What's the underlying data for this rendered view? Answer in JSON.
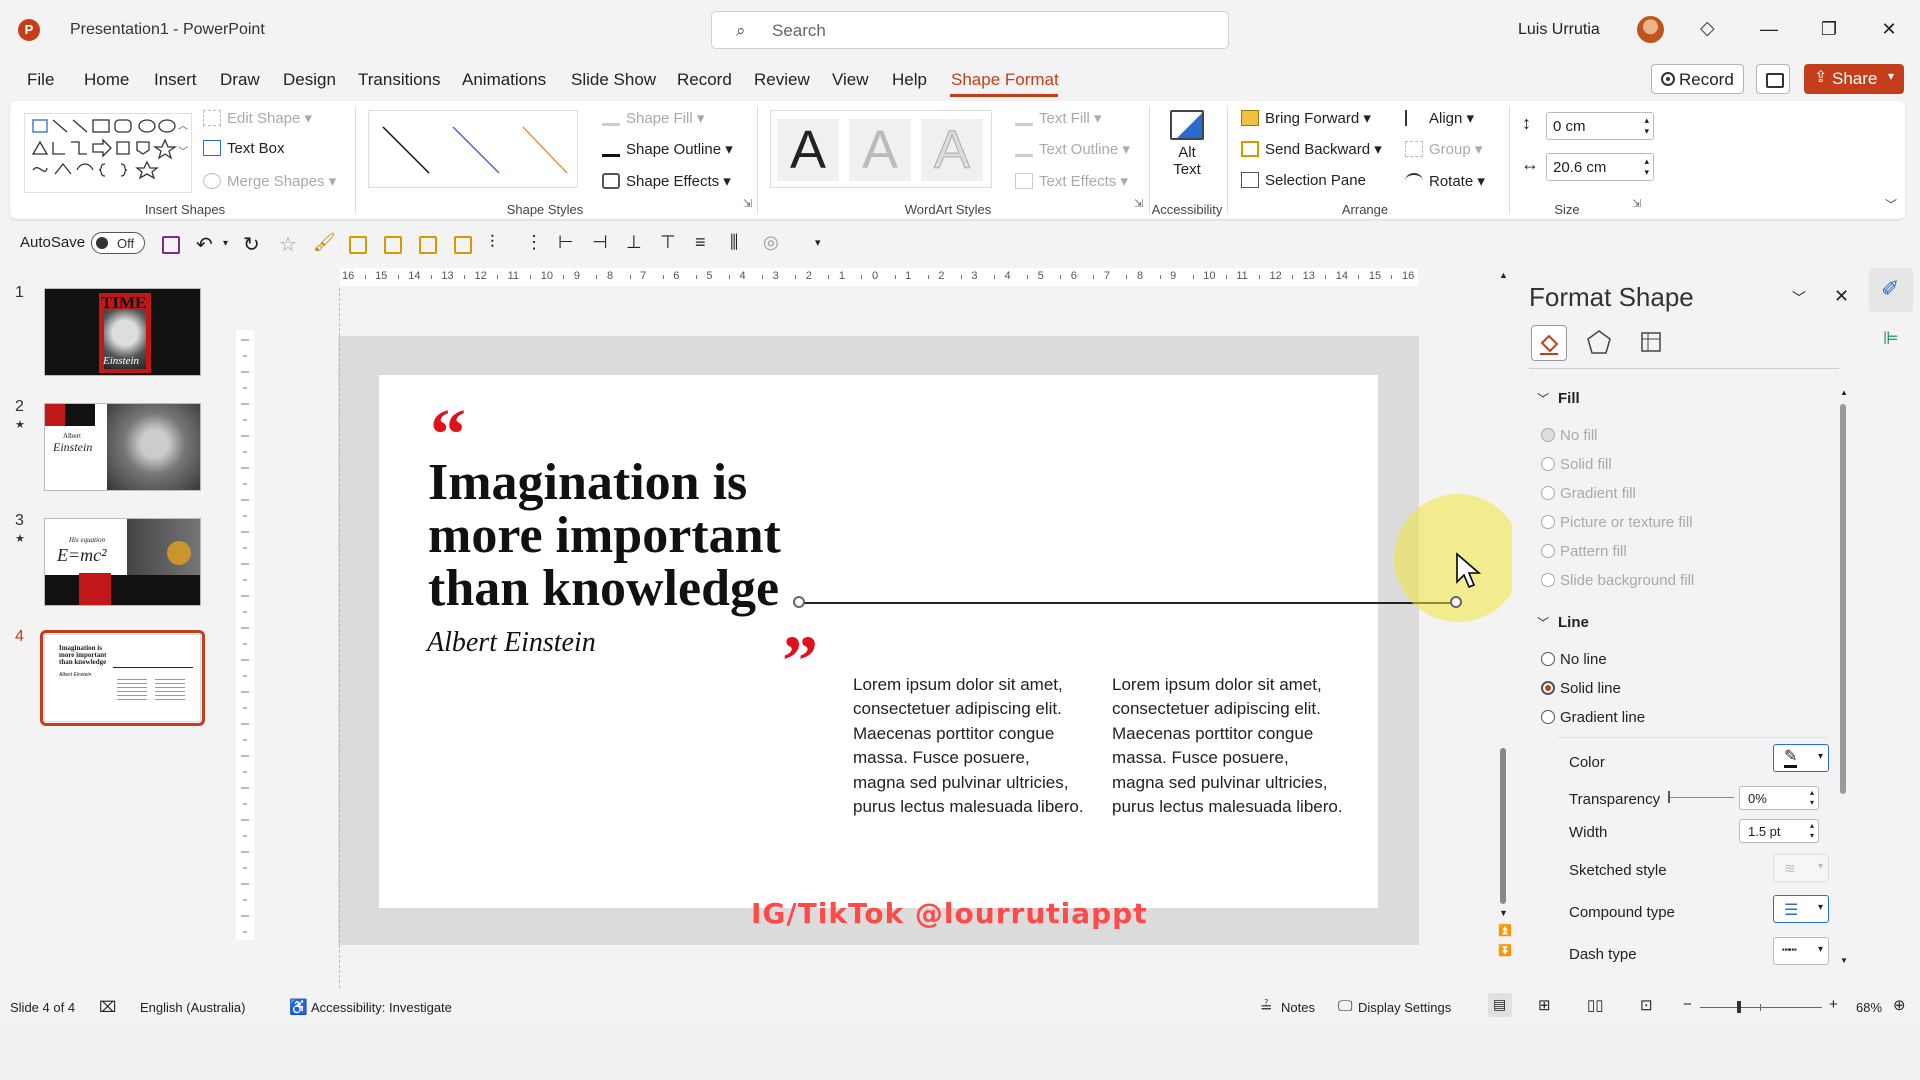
{
  "titlebar": {
    "app_logo": "P",
    "doc_title": "Presentation1  -  PowerPoint",
    "search_placeholder": "Search",
    "user_name": "Luis Urrutia"
  },
  "tabs": [
    "File",
    "Home",
    "Insert",
    "Draw",
    "Design",
    "Transitions",
    "Animations",
    "Slide Show",
    "Record",
    "Review",
    "View",
    "Help",
    "Shape Format"
  ],
  "actions": {
    "record": "Record",
    "share": "Share"
  },
  "ribbon": {
    "insert_shapes": {
      "group": "Insert Shapes",
      "edit_shape": "Edit Shape",
      "text_box": "Text Box",
      "merge_shapes": "Merge Shapes"
    },
    "shape_styles": {
      "group": "Shape Styles",
      "shape_fill": "Shape Fill",
      "shape_outline": "Shape Outline",
      "shape_effects": "Shape Effects"
    },
    "wordart": {
      "group": "WordArt Styles",
      "letter": "A",
      "text_fill": "Text Fill",
      "text_outline": "Text Outline",
      "text_effects": "Text Effects"
    },
    "accessibility": {
      "group": "Accessibility",
      "alt_text_1": "Alt",
      "alt_text_2": "Text"
    },
    "arrange": {
      "group": "Arrange",
      "bring_forward": "Bring Forward",
      "send_backward": "Send Backward",
      "selection_pane": "Selection Pane",
      "align": "Align",
      "group_btn": "Group",
      "rotate": "Rotate"
    },
    "size": {
      "group": "Size",
      "height": "0 cm",
      "width": "20.6 cm"
    }
  },
  "qat": {
    "autosave": "AutoSave",
    "toggle": "Off"
  },
  "ruler_ticks": [
    "16",
    "15",
    "14",
    "13",
    "12",
    "11",
    "10",
    "9",
    "8",
    "7",
    "6",
    "5",
    "4",
    "3",
    "2",
    "1",
    "0",
    "1",
    "2",
    "3",
    "4",
    "5",
    "6",
    "7",
    "8",
    "9",
    "10",
    "11",
    "12",
    "13",
    "14",
    "15",
    "16"
  ],
  "thumbnails": [
    {
      "num": "1",
      "star": ""
    },
    {
      "num": "2",
      "star": "★"
    },
    {
      "num": "3",
      "star": "★"
    },
    {
      "num": "4",
      "star": ""
    }
  ],
  "thumb_text": {
    "t1_title": "TIME",
    "t1_name": "Einstein",
    "t2_small": "Albert",
    "t2_name": "Einstein",
    "t3_small": "His equation",
    "t3_eq": "E=mc²",
    "t4_quote": "Imagination is more important than knowledge",
    "t4_author": "Albert Einstein"
  },
  "slide": {
    "open_quote": "“",
    "quote": "Imagination is more important than knowledge",
    "author": "Albert Einstein",
    "close_quote": "”",
    "lorem_1": "Lorem ipsum dolor sit amet, consectetuer adipiscing elit. Maecenas porttitor congue massa. Fusce posuere, magna sed pulvinar ultricies, purus lectus malesuada libero.",
    "lorem_2": "Lorem ipsum dolor sit amet, consectetuer adipiscing elit. Maecenas porttitor congue massa. Fusce posuere, magna sed pulvinar ultricies, purus lectus malesuada libero."
  },
  "watermark": "IG/TikTok @lourrutiappt",
  "format_pane": {
    "title": "Format Shape",
    "fill": {
      "heading": "Fill",
      "options": [
        "No fill",
        "Solid fill",
        "Gradient fill",
        "Picture or texture fill",
        "Pattern fill",
        "Slide background fill"
      ]
    },
    "line": {
      "heading": "Line",
      "options": [
        "No line",
        "Solid line",
        "Gradient line"
      ],
      "selected": "Solid line"
    },
    "props": {
      "color": "Color",
      "transparency": "Transparency",
      "transparency_val": "0%",
      "width": "Width",
      "width_val": "1.5 pt",
      "sketched": "Sketched style",
      "compound": "Compound type",
      "dash": "Dash type"
    }
  },
  "status": {
    "slide": "Slide 4 of 4",
    "language": "English (Australia)",
    "accessibility": "Accessibility: Investigate",
    "notes": "Notes",
    "display": "Display Settings",
    "zoom": "68%"
  }
}
